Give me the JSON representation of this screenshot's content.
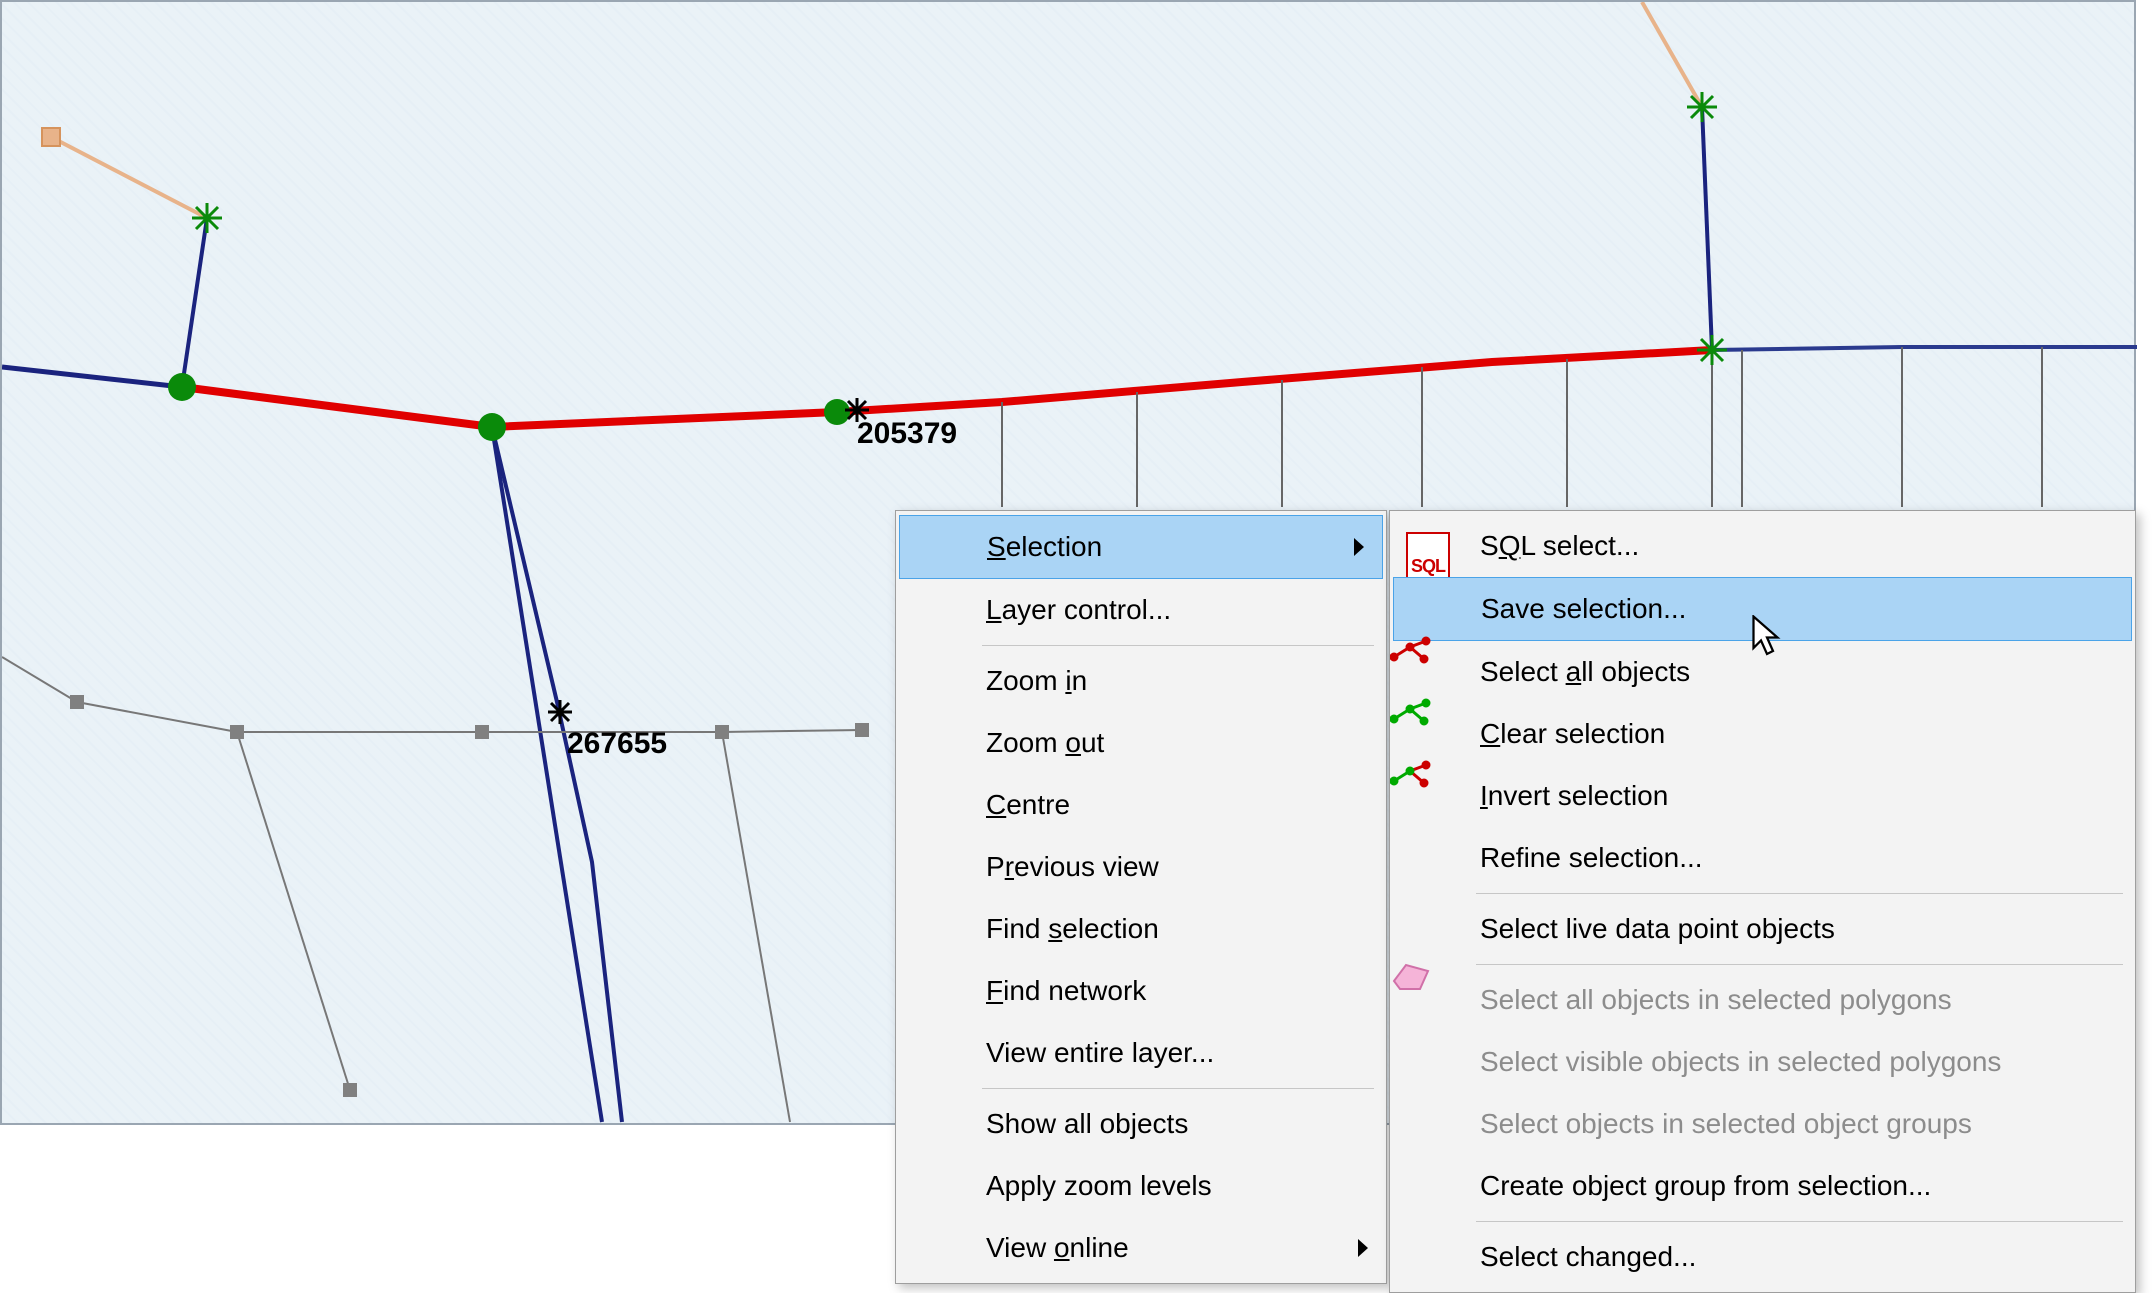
{
  "map": {
    "labels": {
      "id_top": "205379",
      "id_mid": "267655"
    }
  },
  "context_menu": {
    "items": [
      {
        "label": "Selection",
        "accel_index": 0,
        "has_submenu": true,
        "highlighted": true
      },
      {
        "label": "Layer control...",
        "accel_index": 0
      },
      {
        "label": "Zoom in",
        "accel_index": 5
      },
      {
        "label": "Zoom out",
        "accel_index": 5
      },
      {
        "label": "Centre",
        "accel_index": 0
      },
      {
        "label": "Previous view",
        "accel_index": 1
      },
      {
        "label": "Find selection",
        "accel_index": 5
      },
      {
        "label": "Find network",
        "accel_index": 0
      },
      {
        "label": "View entire layer...",
        "accel_index": -1
      },
      {
        "label": "Show all objects",
        "accel_index": -1
      },
      {
        "label": "Apply zoom levels",
        "accel_index": -1
      },
      {
        "label": "View online",
        "accel_index": 5,
        "has_submenu": true
      }
    ],
    "separators_after": [
      1,
      8
    ]
  },
  "selection_submenu": {
    "items": [
      {
        "label": "SQL select...",
        "accel_index": 1,
        "icon": "sql"
      },
      {
        "label": "Save selection...",
        "accel_index": -1,
        "highlighted": true
      },
      {
        "label": "Select all objects",
        "accel_index": 7,
        "icon": "red"
      },
      {
        "label": "Clear selection",
        "accel_index": 0,
        "icon": "green"
      },
      {
        "label": "Invert selection",
        "accel_index": 0,
        "icon": "mix"
      },
      {
        "label": "Refine selection...",
        "accel_index": -1
      },
      {
        "label": "Select live data point objects",
        "accel_index": -1
      },
      {
        "label": "Select all objects in selected polygons",
        "accel_index": -1,
        "icon": "poly",
        "disabled": true
      },
      {
        "label": "Select visible objects in selected polygons",
        "accel_index": -1,
        "disabled": true
      },
      {
        "label": "Select objects in selected object groups",
        "accel_index": -1,
        "disabled": true
      },
      {
        "label": "Create object group from selection...",
        "accel_index": -1
      },
      {
        "label": "Select changed...",
        "accel_index": -1
      }
    ],
    "separators_after": [
      5,
      6,
      10
    ]
  }
}
